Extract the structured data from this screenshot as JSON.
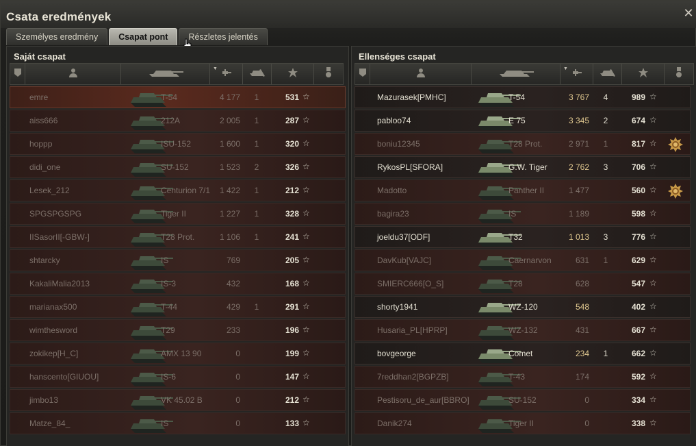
{
  "window": {
    "title": "Csata eredmények"
  },
  "tabs": [
    {
      "label": "Személyes eredmény",
      "active": false
    },
    {
      "label": "Csapat pont",
      "active": true
    },
    {
      "label": "Részletes jelentés",
      "active": false
    }
  ],
  "own_team": {
    "title": "Saját csapat",
    "players": [
      {
        "name": "emre",
        "tank": "T-54",
        "damage": "4 177",
        "kills": "1",
        "xp": "531",
        "alive": false,
        "is_player": true
      },
      {
        "name": "aiss666",
        "tank": "212A",
        "damage": "2 005",
        "kills": "1",
        "xp": "287",
        "alive": false
      },
      {
        "name": "hoppp",
        "tank": "ISU-152",
        "damage": "1 600",
        "kills": "1",
        "xp": "320",
        "alive": false
      },
      {
        "name": "didi_one",
        "tank": "SU-152",
        "damage": "1 523",
        "kills": "2",
        "xp": "326",
        "alive": false
      },
      {
        "name": "Lesek_212",
        "tank": "Centurion 7/1",
        "damage": "1 422",
        "kills": "1",
        "xp": "212",
        "alive": false
      },
      {
        "name": "SPGSPGSPG",
        "tank": "Tiger II",
        "damage": "1 227",
        "kills": "1",
        "xp": "328",
        "alive": false
      },
      {
        "name": "IISasorII[-GBW-]",
        "tank": "T28 Prot.",
        "damage": "1 106",
        "kills": "1",
        "xp": "241",
        "alive": false
      },
      {
        "name": "shtarcky",
        "tank": "IS",
        "damage": "769",
        "kills": "",
        "xp": "205",
        "alive": false
      },
      {
        "name": "KakaliMalia2013",
        "tank": "IS-3",
        "damage": "432",
        "kills": "",
        "xp": "168",
        "alive": false
      },
      {
        "name": "marianax500",
        "tank": "T-44",
        "damage": "429",
        "kills": "1",
        "xp": "291",
        "alive": false
      },
      {
        "name": "wimthesword",
        "tank": "T29",
        "damage": "233",
        "kills": "",
        "xp": "196",
        "alive": false
      },
      {
        "name": "zokikep[H_C]",
        "tank": "AMX 13 90",
        "damage": "0",
        "kills": "",
        "xp": "199",
        "alive": false
      },
      {
        "name": "hanscento[GIUOU]",
        "tank": "IS-6",
        "damage": "0",
        "kills": "",
        "xp": "147",
        "alive": false
      },
      {
        "name": "jimbo13",
        "tank": "VK 45.02 B",
        "damage": "0",
        "kills": "",
        "xp": "212",
        "alive": false
      },
      {
        "name": "Matze_84_",
        "tank": "IS",
        "damage": "0",
        "kills": "",
        "xp": "133",
        "alive": false
      }
    ]
  },
  "enemy_team": {
    "title": "Ellenséges csapat",
    "players": [
      {
        "name": "Mazurasek[PMHC]",
        "tank": "T-54",
        "damage": "3 767",
        "kills": "4",
        "xp": "989",
        "alive": true
      },
      {
        "name": "pabloo74",
        "tank": "E 75",
        "damage": "3 345",
        "kills": "2",
        "xp": "674",
        "alive": true
      },
      {
        "name": "boniu12345",
        "tank": "T28 Prot.",
        "damage": "2 971",
        "kills": "1",
        "xp": "817",
        "alive": false,
        "medal": true
      },
      {
        "name": "RykosPL[SFORA]",
        "tank": "G.W. Tiger",
        "damage": "2 762",
        "kills": "3",
        "xp": "706",
        "alive": true
      },
      {
        "name": "Madotto",
        "tank": "Panther II",
        "damage": "1 477",
        "kills": "",
        "xp": "560",
        "alive": false,
        "medal": true
      },
      {
        "name": "bagira23",
        "tank": "IS",
        "damage": "1 189",
        "kills": "",
        "xp": "598",
        "alive": false
      },
      {
        "name": "joeldu37[ODF]",
        "tank": "T32",
        "damage": "1 013",
        "kills": "3",
        "xp": "776",
        "alive": true
      },
      {
        "name": "DavKub[VAJC]",
        "tank": "Caernarvon",
        "damage": "631",
        "kills": "1",
        "xp": "629",
        "alive": false
      },
      {
        "name": "SMIERC666[O_S]",
        "tank": "T28",
        "damage": "628",
        "kills": "",
        "xp": "547",
        "alive": false
      },
      {
        "name": "shorty1941",
        "tank": "WZ-120",
        "damage": "548",
        "kills": "",
        "xp": "402",
        "alive": true
      },
      {
        "name": "Husaria_PL[HPRP]",
        "tank": "WZ-132",
        "damage": "431",
        "kills": "",
        "xp": "667",
        "alive": false
      },
      {
        "name": "bovgeorge",
        "tank": "Comet",
        "damage": "234",
        "kills": "1",
        "xp": "662",
        "alive": true
      },
      {
        "name": "7reddhan2[BGPZB]",
        "tank": "T-43",
        "damage": "174",
        "kills": "",
        "xp": "592",
        "alive": false
      },
      {
        "name": "Pestisoru_de_aur[BBRO]",
        "tank": "SU-152",
        "damage": "0",
        "kills": "",
        "xp": "334",
        "alive": false
      },
      {
        "name": "Danik274",
        "tank": "Tiger II",
        "damage": "0",
        "kills": "",
        "xp": "338",
        "alive": false
      }
    ]
  },
  "columns": [
    {
      "icon": "platoon-icon"
    },
    {
      "icon": "player-icon"
    },
    {
      "icon": "tank-icon"
    },
    {
      "icon": "damage-icon",
      "sorted": true
    },
    {
      "icon": "kills-icon"
    },
    {
      "icon": "xp-star-icon"
    },
    {
      "icon": "medal-icon"
    }
  ],
  "colors": {
    "accent": "#e0c890",
    "dead_row": "#3a2420",
    "alive_row": "#2a2220",
    "own_row": "#5a2a1e"
  }
}
